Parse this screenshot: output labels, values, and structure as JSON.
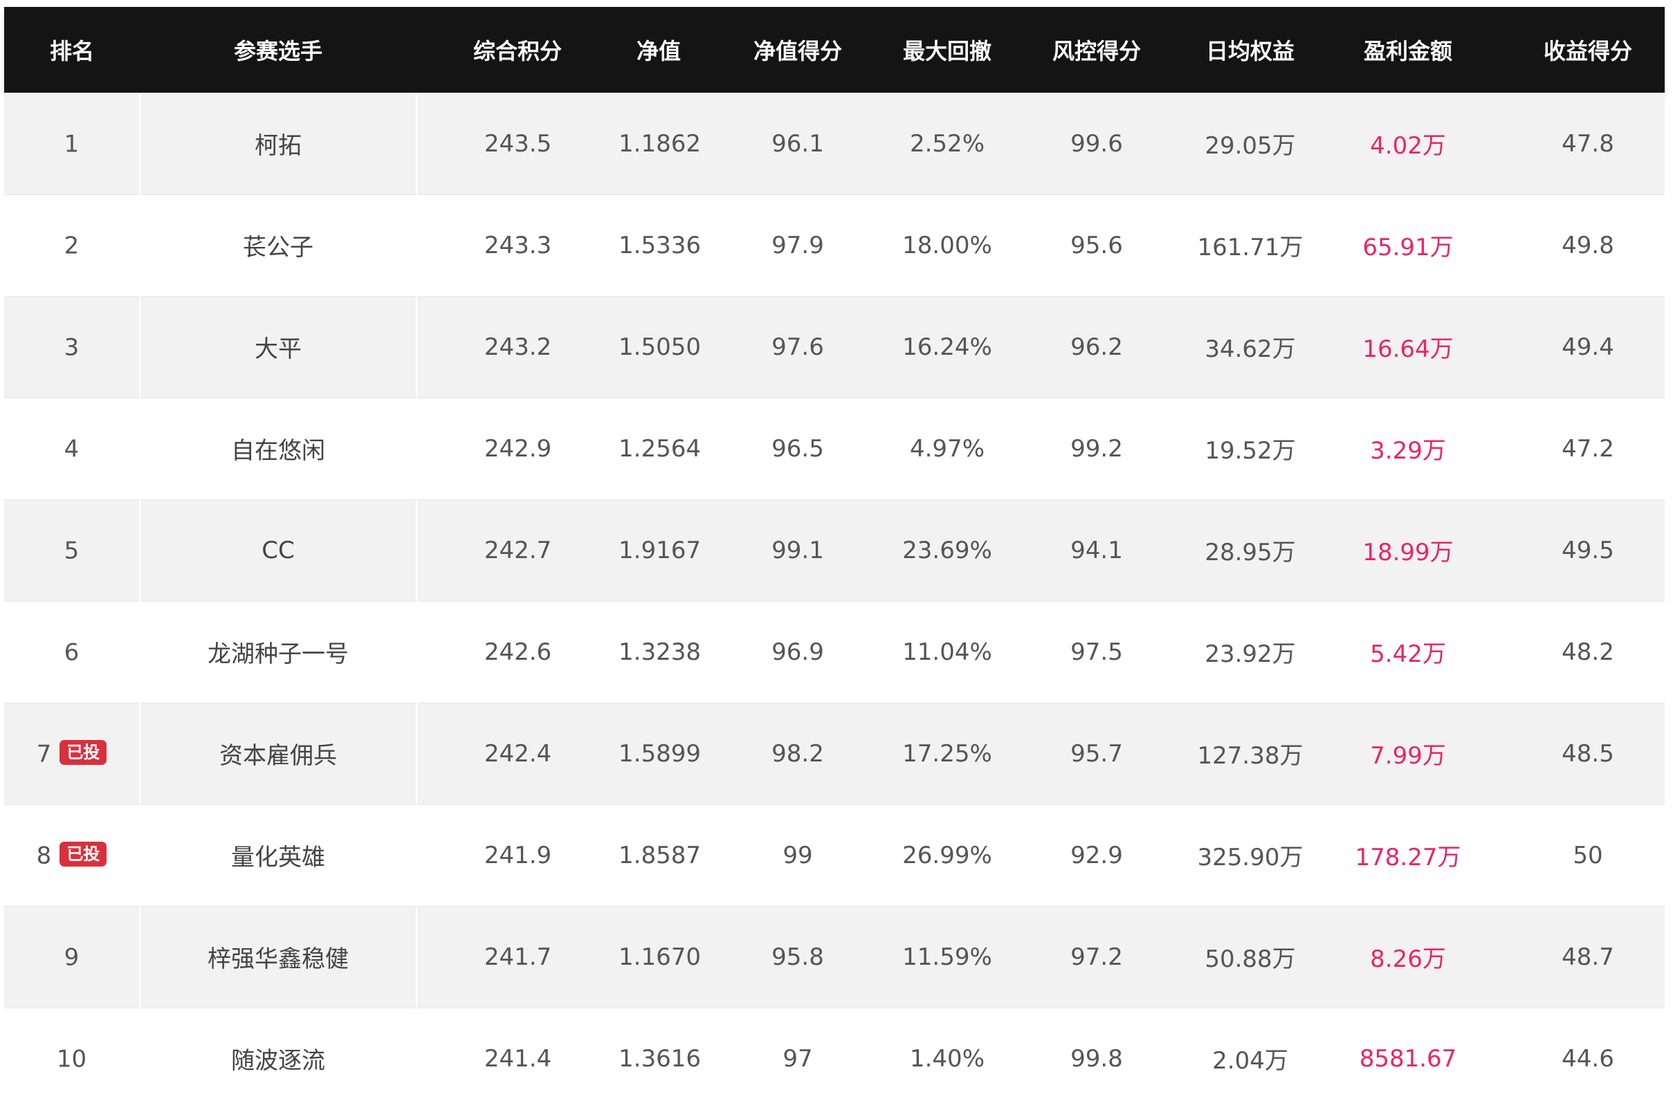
{
  "table": {
    "headers": [
      "排名",
      "参赛选手",
      "综合积分",
      "净值",
      "净值得分",
      "最大回撤",
      "风控得分",
      "日均权益",
      "盈利金额",
      "收益得分"
    ],
    "rows": [
      {
        "rank": "1",
        "badge": "",
        "name": "柯拓",
        "score": "243.5",
        "nav": "1.1862",
        "nav_score": "96.1",
        "max_drawdown": "2.52%",
        "risk_score": "99.6",
        "avg_equity": "29.05万",
        "profit": "4.02万",
        "return_score": "47.8"
      },
      {
        "rank": "2",
        "badge": "",
        "name": "苌公子",
        "score": "243.3",
        "nav": "1.5336",
        "nav_score": "97.9",
        "max_drawdown": "18.00%",
        "risk_score": "95.6",
        "avg_equity": "161.71万",
        "profit": "65.91万",
        "return_score": "49.8"
      },
      {
        "rank": "3",
        "badge": "",
        "name": "大平",
        "score": "243.2",
        "nav": "1.5050",
        "nav_score": "97.6",
        "max_drawdown": "16.24%",
        "risk_score": "96.2",
        "avg_equity": "34.62万",
        "profit": "16.64万",
        "return_score": "49.4"
      },
      {
        "rank": "4",
        "badge": "",
        "name": "自在悠闲",
        "score": "242.9",
        "nav": "1.2564",
        "nav_score": "96.5",
        "max_drawdown": "4.97%",
        "risk_score": "99.2",
        "avg_equity": "19.52万",
        "profit": "3.29万",
        "return_score": "47.2"
      },
      {
        "rank": "5",
        "badge": "",
        "name": "CC",
        "score": "242.7",
        "nav": "1.9167",
        "nav_score": "99.1",
        "max_drawdown": "23.69%",
        "risk_score": "94.1",
        "avg_equity": "28.95万",
        "profit": "18.99万",
        "return_score": "49.5"
      },
      {
        "rank": "6",
        "badge": "",
        "name": "龙湖种子一号",
        "score": "242.6",
        "nav": "1.3238",
        "nav_score": "96.9",
        "max_drawdown": "11.04%",
        "risk_score": "97.5",
        "avg_equity": "23.92万",
        "profit": "5.42万",
        "return_score": "48.2"
      },
      {
        "rank": "7",
        "badge": "已投",
        "name": "资本雇佣兵",
        "score": "242.4",
        "nav": "1.5899",
        "nav_score": "98.2",
        "max_drawdown": "17.25%",
        "risk_score": "95.7",
        "avg_equity": "127.38万",
        "profit": "7.99万",
        "return_score": "48.5"
      },
      {
        "rank": "8",
        "badge": "已投",
        "name": "量化英雄",
        "score": "241.9",
        "nav": "1.8587",
        "nav_score": "99",
        "max_drawdown": "26.99%",
        "risk_score": "92.9",
        "avg_equity": "325.90万",
        "profit": "178.27万",
        "return_score": "50"
      },
      {
        "rank": "9",
        "badge": "",
        "name": "梓强华鑫稳健",
        "score": "241.7",
        "nav": "1.1670",
        "nav_score": "95.8",
        "max_drawdown": "11.59%",
        "risk_score": "97.2",
        "avg_equity": "50.88万",
        "profit": "8.26万",
        "return_score": "48.7"
      },
      {
        "rank": "10",
        "badge": "",
        "name": "随波逐流",
        "score": "241.4",
        "nav": "1.3616",
        "nav_score": "97",
        "max_drawdown": "1.40%",
        "risk_score": "99.8",
        "avg_equity": "2.04万",
        "profit": "8581.67",
        "return_score": "44.6"
      }
    ]
  },
  "colors": {
    "header_bg": "#141414",
    "row_alt_bg": "#f2f2f2",
    "profit_text": "#e8246a",
    "badge_bg": "#d9303e"
  }
}
